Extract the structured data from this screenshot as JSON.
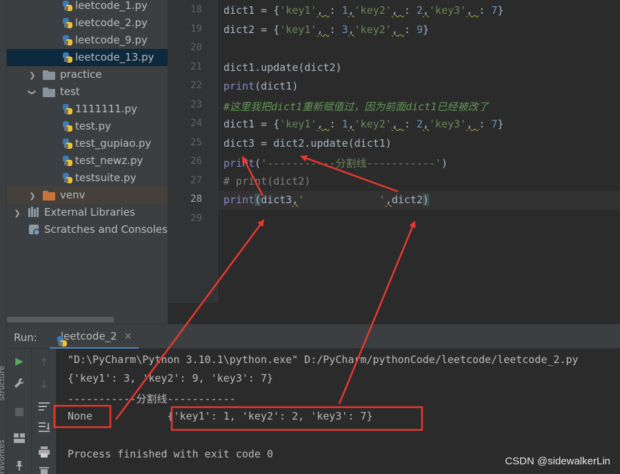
{
  "project_tree": {
    "items": [
      {
        "label": "leetcode_1.py",
        "type": "py"
      },
      {
        "label": "leetcode_2.py",
        "type": "py"
      },
      {
        "label": "leetcode_9.py",
        "type": "py"
      },
      {
        "label": "leetcode_13.py",
        "type": "py",
        "selected": true
      },
      {
        "label": "practice",
        "type": "folder"
      },
      {
        "label": "test",
        "type": "folder"
      },
      {
        "label": "1111111.py",
        "type": "py"
      },
      {
        "label": "test.py",
        "type": "py"
      },
      {
        "label": "test_gupiao.py",
        "type": "py"
      },
      {
        "label": "test_newz.py",
        "type": "py"
      },
      {
        "label": "testsuite.py",
        "type": "py"
      },
      {
        "label": "venv",
        "type": "folder"
      },
      {
        "label": "External Libraries",
        "type": "libraries"
      },
      {
        "label": "Scratches and Consoles",
        "type": "scratches"
      }
    ]
  },
  "editor": {
    "line_numbers": [
      "18",
      "19",
      "20",
      "21",
      "22",
      "23",
      "24",
      "25",
      "26",
      "27",
      "28",
      "29"
    ],
    "current_line": "28",
    "lines": [
      {
        "p": [
          [
            "dict1 = {",
            ""
          ],
          [
            "'key1'",
            "k"
          ],
          [
            ", ",
            "u"
          ],
          [
            ": ",
            ""
          ],
          [
            "1",
            "n"
          ],
          [
            ",",
            "u"
          ],
          [
            "'key2'",
            "k"
          ],
          [
            ", ",
            "u"
          ],
          [
            ": ",
            ""
          ],
          [
            "2",
            "n"
          ],
          [
            ",",
            "u"
          ],
          [
            "'key3'",
            "k"
          ],
          [
            ", ",
            "u"
          ],
          [
            ": ",
            ""
          ],
          [
            "7",
            "n"
          ],
          [
            "}",
            ""
          ]
        ]
      },
      {
        "p": [
          [
            "dict2 = {",
            ""
          ],
          [
            "'key1'",
            "k"
          ],
          [
            ", ",
            "u"
          ],
          [
            ": ",
            ""
          ],
          [
            "3",
            "n"
          ],
          [
            ",",
            "u"
          ],
          [
            "'key2'",
            "k"
          ],
          [
            ", ",
            "u"
          ],
          [
            ": ",
            ""
          ],
          [
            "9",
            "n"
          ],
          [
            "}",
            ""
          ]
        ]
      },
      {
        "p": []
      },
      {
        "p": [
          [
            "dict1.update(dict2)",
            ""
          ]
        ]
      },
      {
        "p": [
          [
            "print",
            "f"
          ],
          [
            "(dict1)",
            ""
          ]
        ]
      },
      {
        "p": [
          [
            "#这里我把dict1重新赋值过，因为前面dict1已经被改了",
            "td"
          ]
        ]
      },
      {
        "p": [
          [
            "dict1 = {",
            ""
          ],
          [
            "'key1'",
            "k"
          ],
          [
            ", ",
            "u"
          ],
          [
            ": ",
            ""
          ],
          [
            "1",
            "n"
          ],
          [
            ",",
            "u"
          ],
          [
            "'key2'",
            "k"
          ],
          [
            ", ",
            "u"
          ],
          [
            ": ",
            ""
          ],
          [
            "2",
            "n"
          ],
          [
            ",",
            "u"
          ],
          [
            "'key3'",
            "k"
          ],
          [
            ", ",
            "u"
          ],
          [
            ": ",
            ""
          ],
          [
            "7",
            "n"
          ],
          [
            "}",
            ""
          ]
        ]
      },
      {
        "p": [
          [
            "dict3 = dict2.update(dict1)",
            ""
          ]
        ]
      },
      {
        "p": [
          [
            "print",
            "f"
          ],
          [
            "(",
            ""
          ],
          [
            "'-----------分割线-----------'",
            "k"
          ],
          [
            ")",
            ""
          ]
        ]
      },
      {
        "p": [
          [
            "# print(dict2)",
            "cm"
          ]
        ]
      },
      {
        "p": [
          [
            "print",
            "f"
          ],
          [
            "(",
            "hl"
          ],
          [
            "dict3",
            ""
          ],
          [
            ",",
            "u"
          ],
          [
            "'            '",
            "k"
          ],
          [
            ",",
            "u"
          ],
          [
            "dict2",
            ""
          ],
          [
            ")",
            "hl"
          ]
        ]
      },
      {
        "p": []
      }
    ]
  },
  "run_panel": {
    "label": "Run:",
    "tab_label": "leetcode_2",
    "close_glyph": "×",
    "console_lines": [
      "\"D:\\PyCharm\\Python 3.10.1\\python.exe\" D:/PyCharm/pythonCode/leetcode/leetcode_2.py",
      "{'key1': 3, 'key2': 9, 'key3': 7}",
      "-----------分割线-----------",
      "None            {'key1': 1, 'key2': 2, 'key3': 7}",
      "",
      "Process finished with exit code 0"
    ]
  },
  "side_labels": {
    "structure": "Structure",
    "favorites": "Favorites"
  },
  "watermark": "CSDN @sidewalkerLin",
  "colors": {
    "annotation": "#e8382f",
    "selection": "#0d293e",
    "accent": "#4a88c7"
  }
}
